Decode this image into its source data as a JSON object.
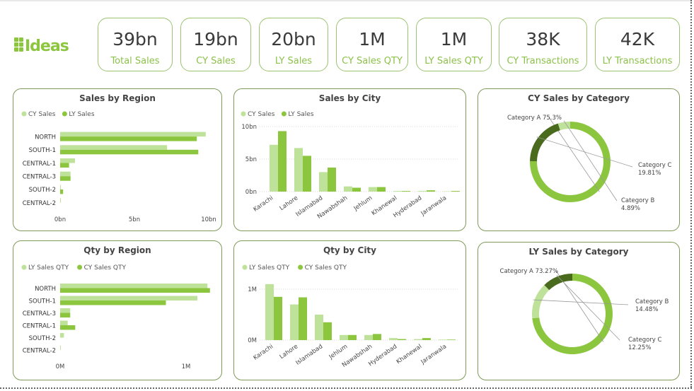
{
  "logo": {
    "text": "Ideas"
  },
  "kpis": [
    {
      "value": "39bn",
      "label": "Total Sales"
    },
    {
      "value": "19bn",
      "label": "CY Sales"
    },
    {
      "value": "20bn",
      "label": "LY Sales"
    },
    {
      "value": "1M",
      "label": "CY Sales QTY"
    },
    {
      "value": "1M",
      "label": "LY Sales QTY"
    },
    {
      "value": "38K",
      "label": "CY Transactions"
    },
    {
      "value": "42K",
      "label": "LY Transactions"
    }
  ],
  "colors": {
    "light": "#bfe29a",
    "dark": "#8cc63f",
    "darkest": "#4a6b1e",
    "accent": "#8cc14a"
  },
  "chart_data": [
    {
      "id": "sales-by-region",
      "type": "bar",
      "orientation": "horizontal",
      "title": "Sales by Region",
      "categories": [
        "NORTH",
        "SOUTH-1",
        "CENTRAL-1",
        "CENTRAL-3",
        "SOUTH-2",
        "CENTRAL-2"
      ],
      "series": [
        {
          "name": "CY Sales",
          "color": "#bfe29a",
          "values": [
            9.8,
            7.2,
            1.0,
            0.7,
            0.05,
            0.05
          ]
        },
        {
          "name": "LY Sales",
          "color": "#8cc63f",
          "values": [
            9.2,
            9.3,
            0.6,
            0.7,
            0.2,
            0.0
          ]
        }
      ],
      "xlim": [
        0,
        10
      ],
      "ticks": [
        "0bn",
        "5bn",
        "10bn"
      ],
      "legend": "top-left"
    },
    {
      "id": "sales-by-city",
      "type": "bar",
      "orientation": "vertical",
      "title": "Sales by City",
      "categories": [
        "Karachi",
        "Lahore",
        "Islamabad",
        "Nawabshah",
        "Jehlum",
        "Khanewal",
        "Hyderabad",
        "Jaranwala"
      ],
      "series": [
        {
          "name": "CY Sales",
          "color": "#bfe29a",
          "values": [
            7.2,
            6.7,
            3.0,
            0.8,
            0.7,
            0.1,
            0.1,
            0.05
          ]
        },
        {
          "name": "LY Sales",
          "color": "#8cc63f",
          "values": [
            9.3,
            5.5,
            3.7,
            0.6,
            0.7,
            0.1,
            0.2,
            0.1
          ]
        }
      ],
      "ylim": [
        0,
        10
      ],
      "ticks": [
        "0bn",
        "5bn",
        "10bn"
      ],
      "legend": "top-left"
    },
    {
      "id": "cy-sales-by-category",
      "type": "pie",
      "title": "CY Sales by Category",
      "slices": [
        {
          "label": "Category A",
          "value": 75.3,
          "text": "Category A 75.3%",
          "color": "#8cc63f"
        },
        {
          "label": "Category C",
          "value": 19.81,
          "text": [
            "Category C",
            "19.81%"
          ],
          "color": "#4a6b1e"
        },
        {
          "label": "Category B",
          "value": 4.89,
          "text": [
            "Category B",
            "4.89%"
          ],
          "color": "#bfe29a"
        }
      ]
    },
    {
      "id": "qty-by-region",
      "type": "bar",
      "orientation": "horizontal",
      "title": "Qty by Region",
      "categories": [
        "NORTH",
        "SOUTH-1",
        "CENTRAL-3",
        "CENTRAL-1",
        "SOUTH-2",
        "CENTRAL-2"
      ],
      "series": [
        {
          "name": "LY Sales QTY",
          "color": "#bfe29a",
          "values": [
            1.17,
            1.09,
            0.08,
            0.06,
            0.03,
            0.005
          ]
        },
        {
          "name": "CY Sales QTY",
          "color": "#8cc63f",
          "values": [
            1.19,
            0.84,
            0.08,
            0.12,
            0.0,
            0.0
          ]
        }
      ],
      "xlim": [
        0,
        1
      ],
      "ticks": [
        "0M",
        "1M"
      ],
      "legend": "top-left"
    },
    {
      "id": "qty-by-city",
      "type": "bar",
      "orientation": "vertical",
      "title": "Qty by City",
      "categories": [
        "Karachi",
        "Lahore",
        "Islamabad",
        "Jehlum",
        "Nawabshah",
        "Hyderabad",
        "Khanewal",
        "Jaranwala"
      ],
      "series": [
        {
          "name": "LY Sales QTY",
          "color": "#bfe29a",
          "values": [
            1.1,
            0.7,
            0.5,
            0.1,
            0.1,
            0.04,
            0.02,
            0.01
          ]
        },
        {
          "name": "CY Sales QTY",
          "color": "#8cc63f",
          "values": [
            0.85,
            0.84,
            0.35,
            0.1,
            0.12,
            0.02,
            0.04,
            0.01
          ]
        }
      ],
      "ylim": [
        0,
        1
      ],
      "ticks": [
        "0M",
        "1M"
      ],
      "legend": "top-left"
    },
    {
      "id": "ly-sales-by-category",
      "type": "pie",
      "title": "LY Sales by Category",
      "slices": [
        {
          "label": "Category A",
          "value": 73.27,
          "text": "Category A 73.27%",
          "color": "#8cc63f"
        },
        {
          "label": "Category B",
          "value": 14.48,
          "text": [
            "Category B",
            "14.48%"
          ],
          "color": "#bfe29a"
        },
        {
          "label": "Category C",
          "value": 12.25,
          "text": [
            "Category C",
            "12.25%"
          ],
          "color": "#4a6b1e"
        }
      ]
    }
  ]
}
